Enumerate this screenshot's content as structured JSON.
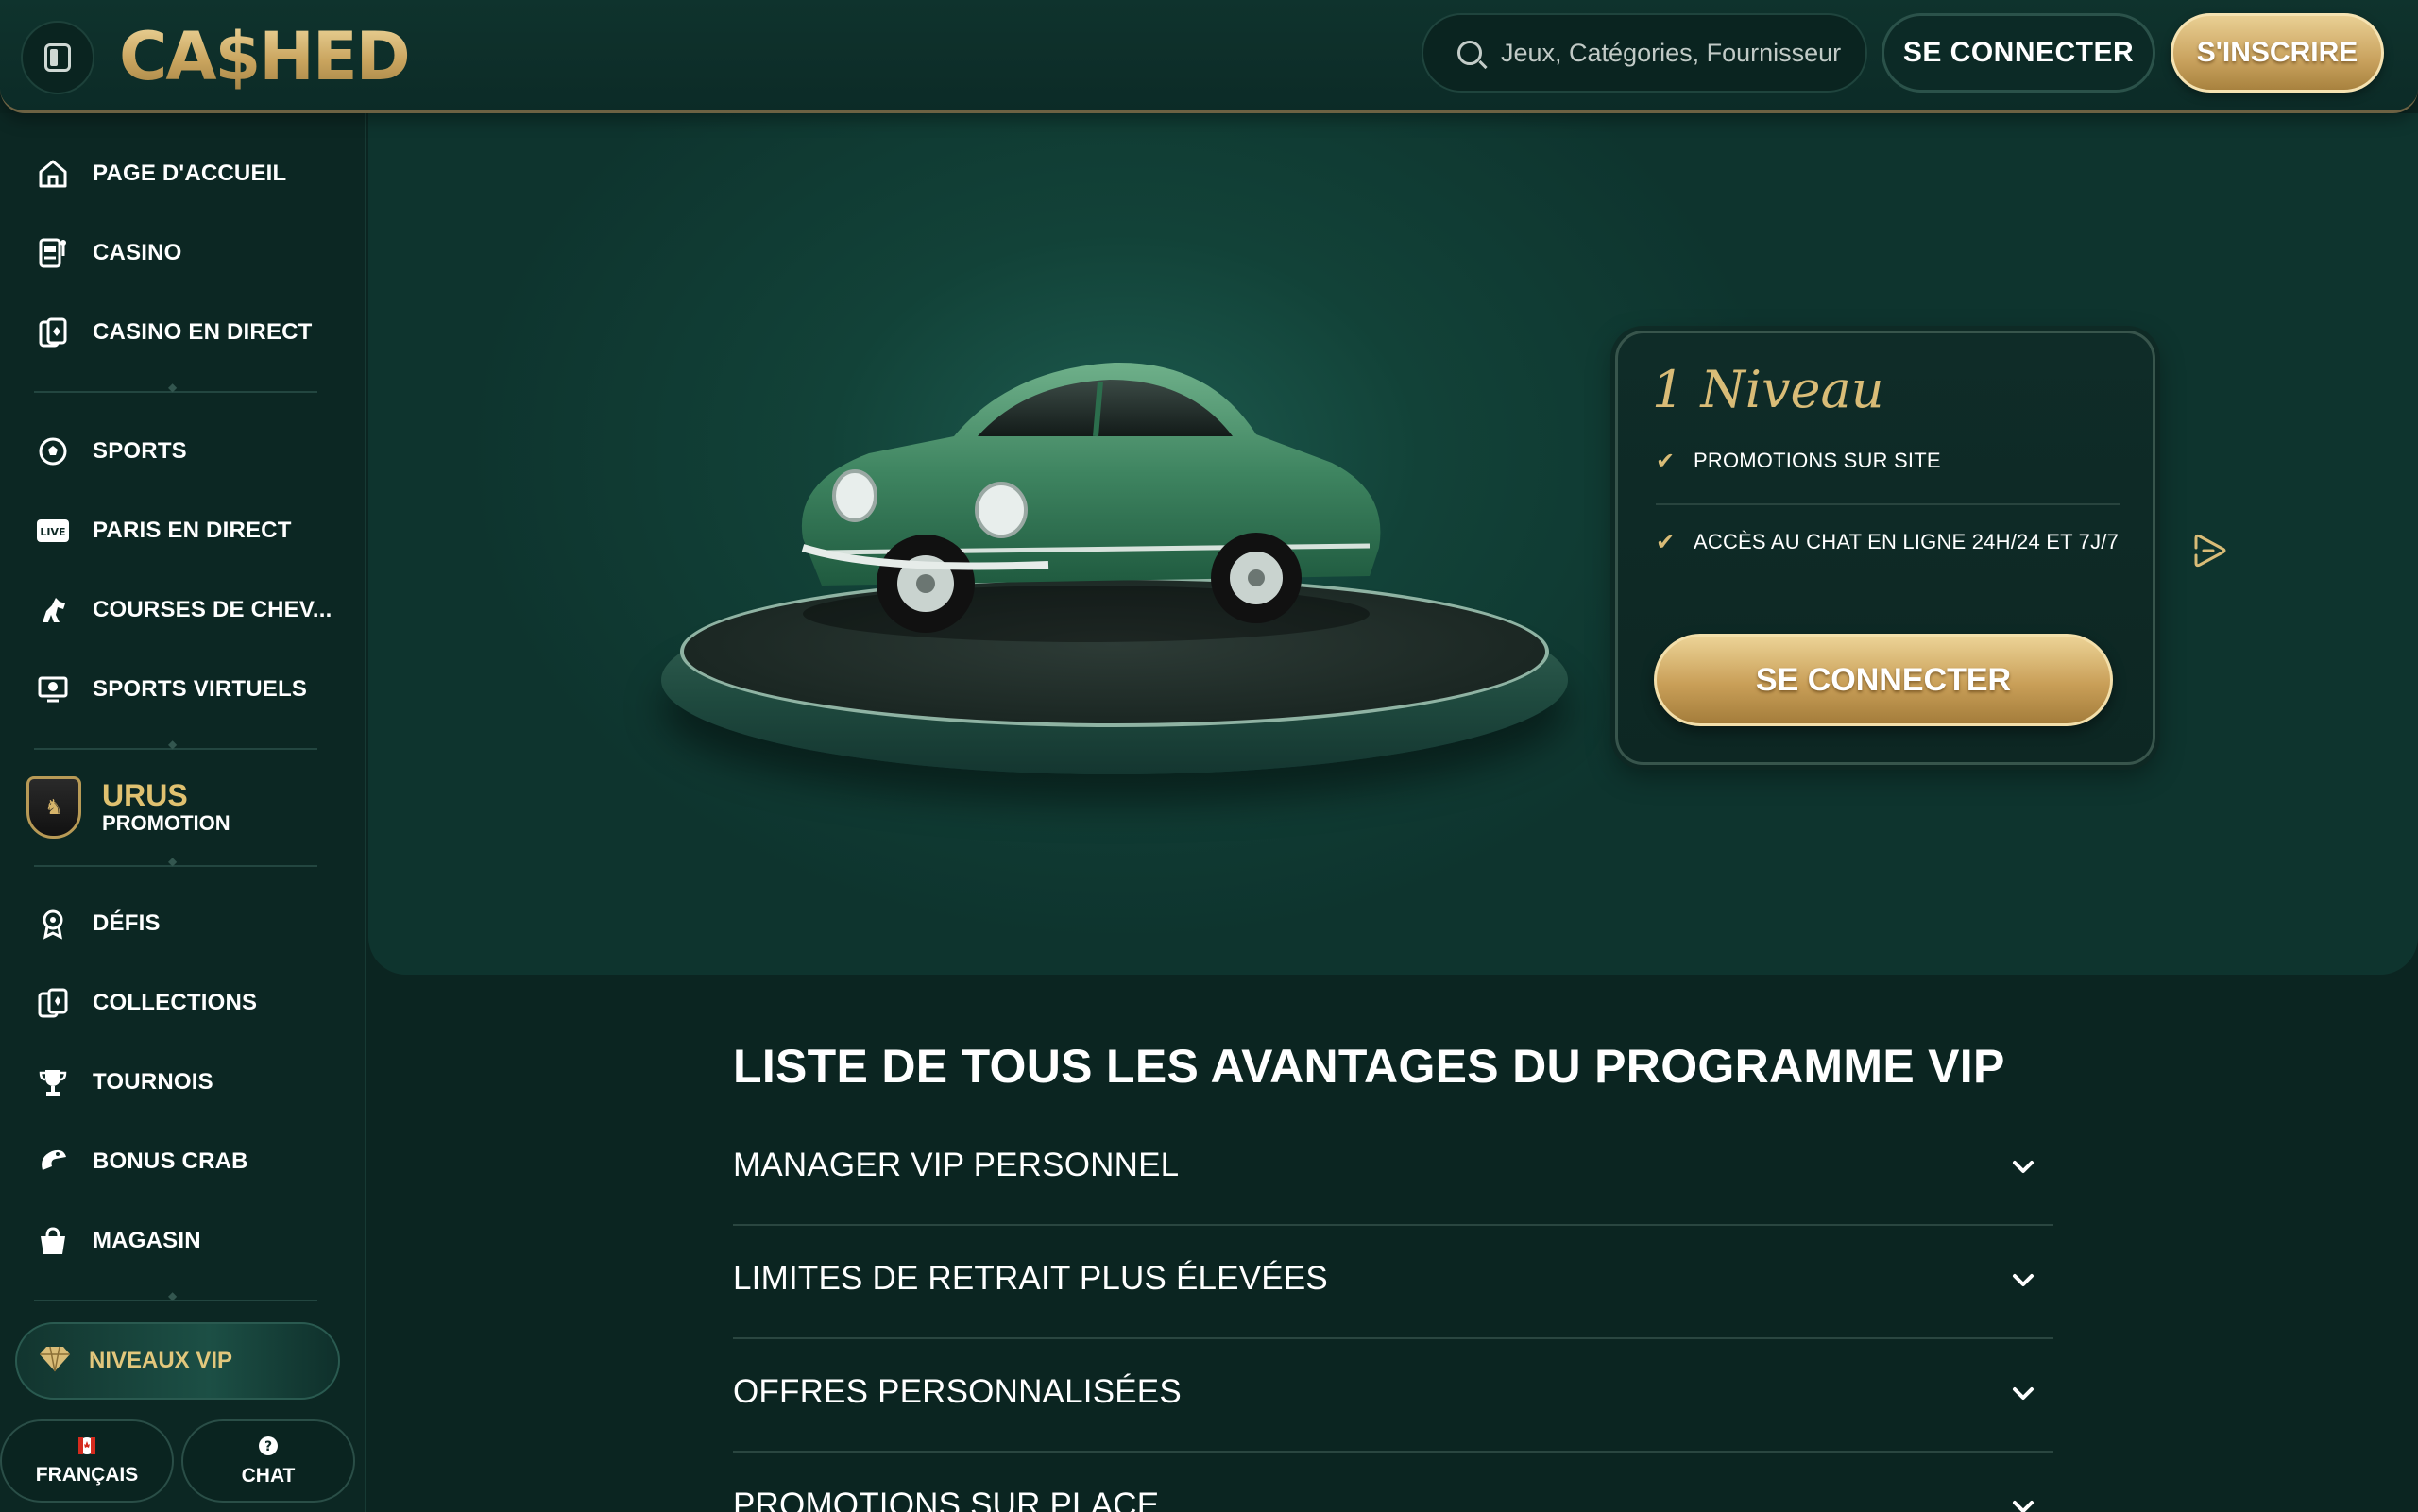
{
  "header": {
    "logo_text": "CA$HED",
    "search_placeholder": "Jeux, Catégories, Fournisseurs",
    "login_label": "SE CONNECTER",
    "signup_label": "S'INSCRIRE"
  },
  "sidebar": {
    "items": [
      {
        "label": "PAGE D'ACCUEIL",
        "icon": "home-icon"
      },
      {
        "label": "CASINO",
        "icon": "slot-machine-icon"
      },
      {
        "label": "CASINO EN DIRECT",
        "icon": "live-cards-icon"
      },
      {
        "label": "SPORTS",
        "icon": "soccer-ball-icon"
      },
      {
        "label": "PARIS EN DIRECT",
        "icon": "live-badge-icon"
      },
      {
        "label": "COURSES DE CHEV...",
        "icon": "horse-icon"
      },
      {
        "label": "SPORTS VIRTUELS",
        "icon": "virtual-sports-icon"
      },
      {
        "label": "DÉFIS",
        "icon": "medal-icon"
      },
      {
        "label": "COLLECTIONS",
        "icon": "cards-icon"
      },
      {
        "label": "TOURNOIS",
        "icon": "trophy-icon"
      },
      {
        "label": "BONUS CRAB",
        "icon": "crab-claw-icon"
      },
      {
        "label": "MAGASIN",
        "icon": "shopping-bag-icon"
      }
    ],
    "promo": {
      "title": "URUS",
      "subtitle": "PROMOTION"
    },
    "vip_label": "NIVEAUX VIP",
    "language_label": "FRANÇAIS",
    "chat_label": "CHAT"
  },
  "hero": {
    "level_title": "1 Niveau",
    "perks": [
      "PROMOTIONS SUR SITE",
      "ACCÈS AU CHAT EN LIGNE 24H/24 ET 7J/7"
    ],
    "login_label": "SE CONNECTER"
  },
  "benefits": {
    "title": "LISTE DE TOUS LES AVANTAGES DU PROGRAMME VIP",
    "items": [
      "MANAGER VIP PERSONNEL",
      "LIMITES DE RETRAIT PLUS ÉLEVÉES",
      "OFFRES PERSONNALISÉES",
      "PROMOTIONS SUR PLACE"
    ]
  },
  "colors": {
    "gold": "#d9bc77",
    "background": "#0b2521",
    "panel": "#0f2c28"
  }
}
